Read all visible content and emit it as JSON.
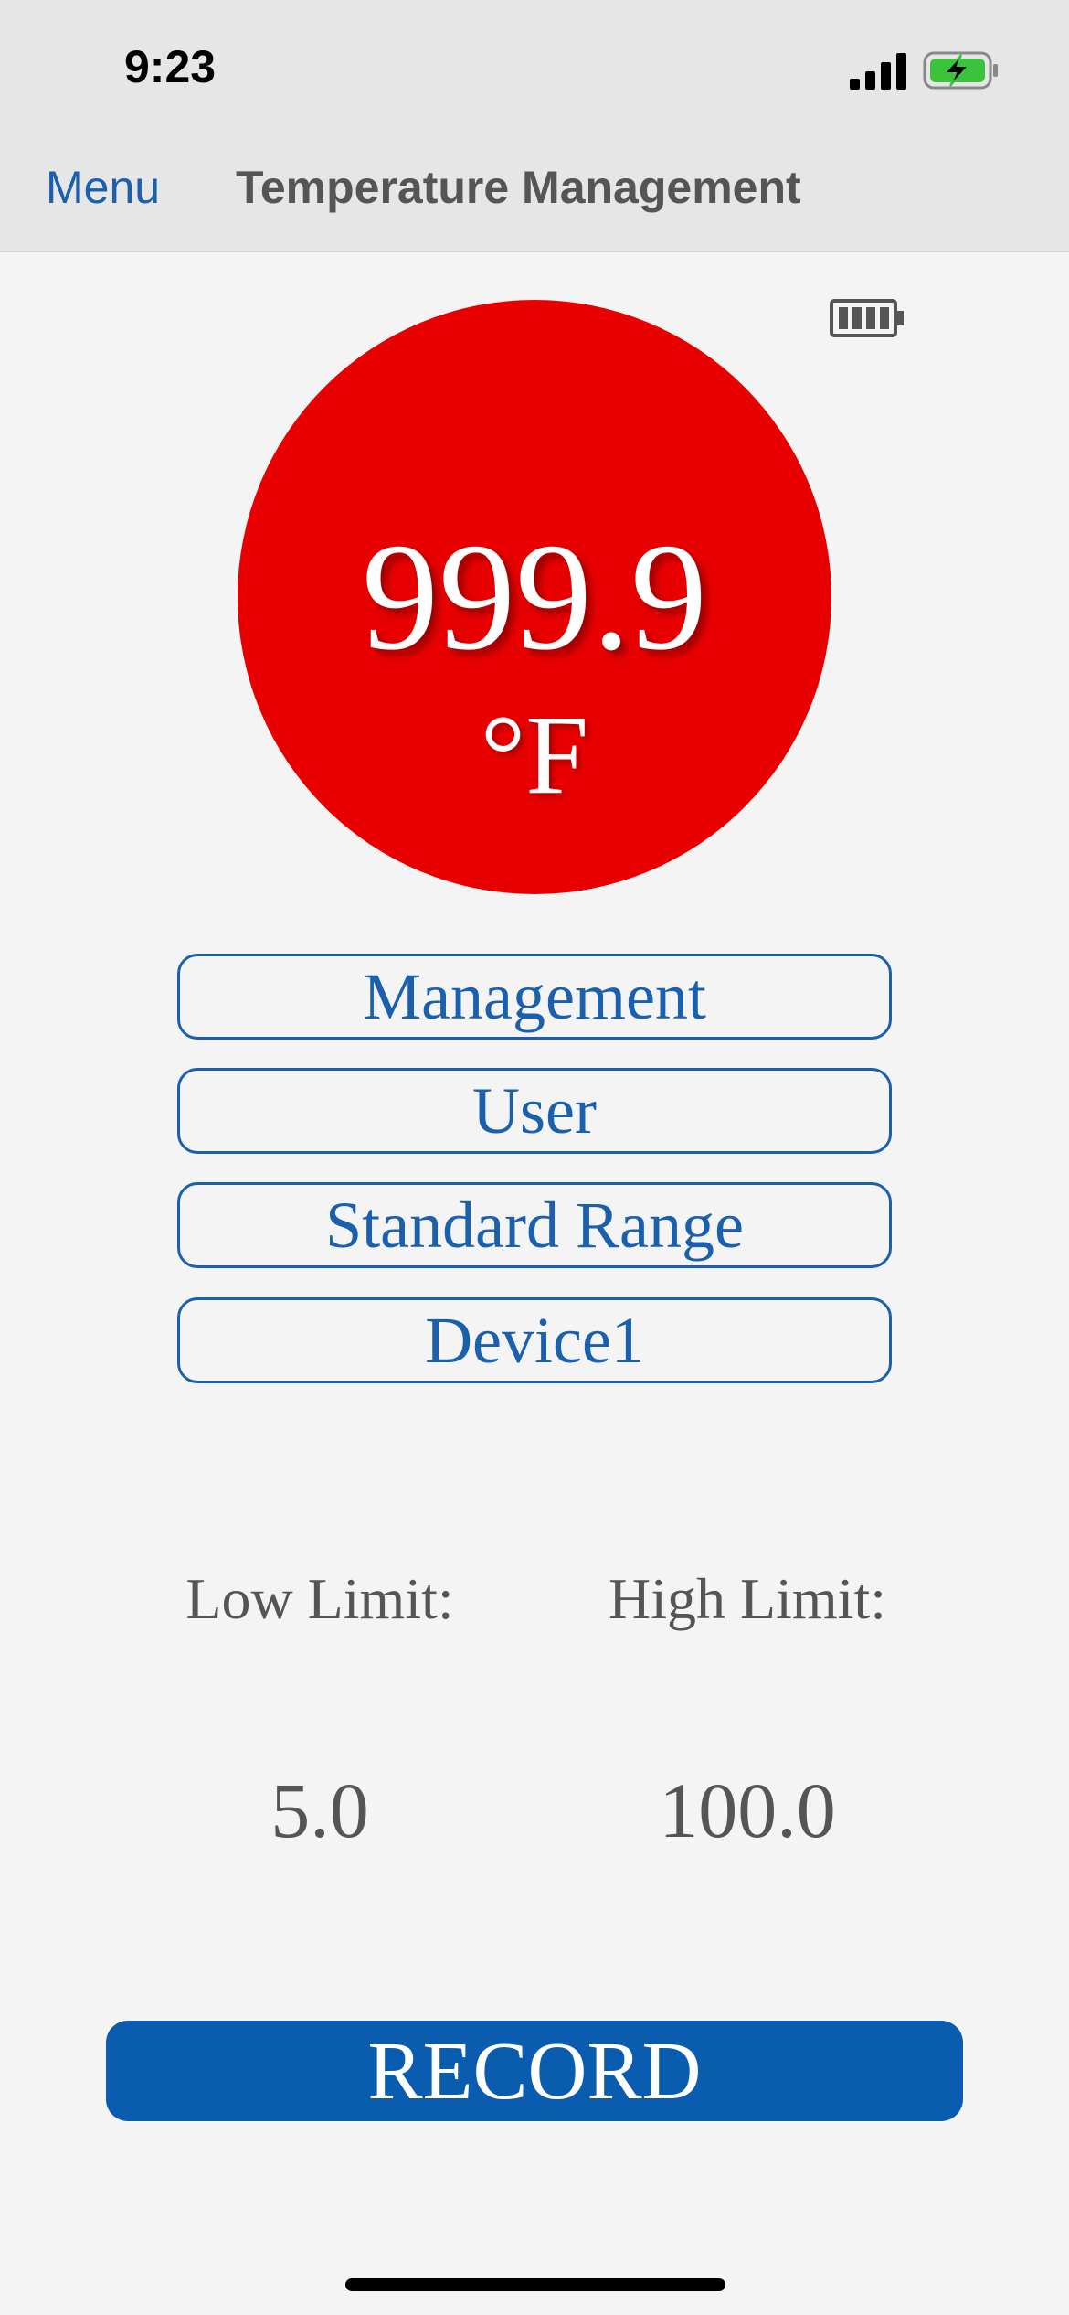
{
  "status_bar": {
    "time": "9:23",
    "icons": [
      "signal-icon",
      "battery-charging-icon"
    ],
    "battery_color": "#3cc23c"
  },
  "nav": {
    "menu_label": "Menu",
    "title": "Temperature Management"
  },
  "device_battery": {
    "icon": "battery-icon"
  },
  "reading": {
    "value": "999.9",
    "unit": "°F",
    "indicator_color": "#e80000"
  },
  "selectors": [
    {
      "label": "Management"
    },
    {
      "label": "User"
    },
    {
      "label": "Standard Range"
    },
    {
      "label": "Device1"
    }
  ],
  "limits": {
    "low_label": "Low Limit:",
    "low_value": "5.0",
    "high_label": "High Limit:",
    "high_value": "100.0"
  },
  "record_button": {
    "label": "RECORD",
    "color": "#0a5cae"
  },
  "accent_color": "#1a60ad"
}
